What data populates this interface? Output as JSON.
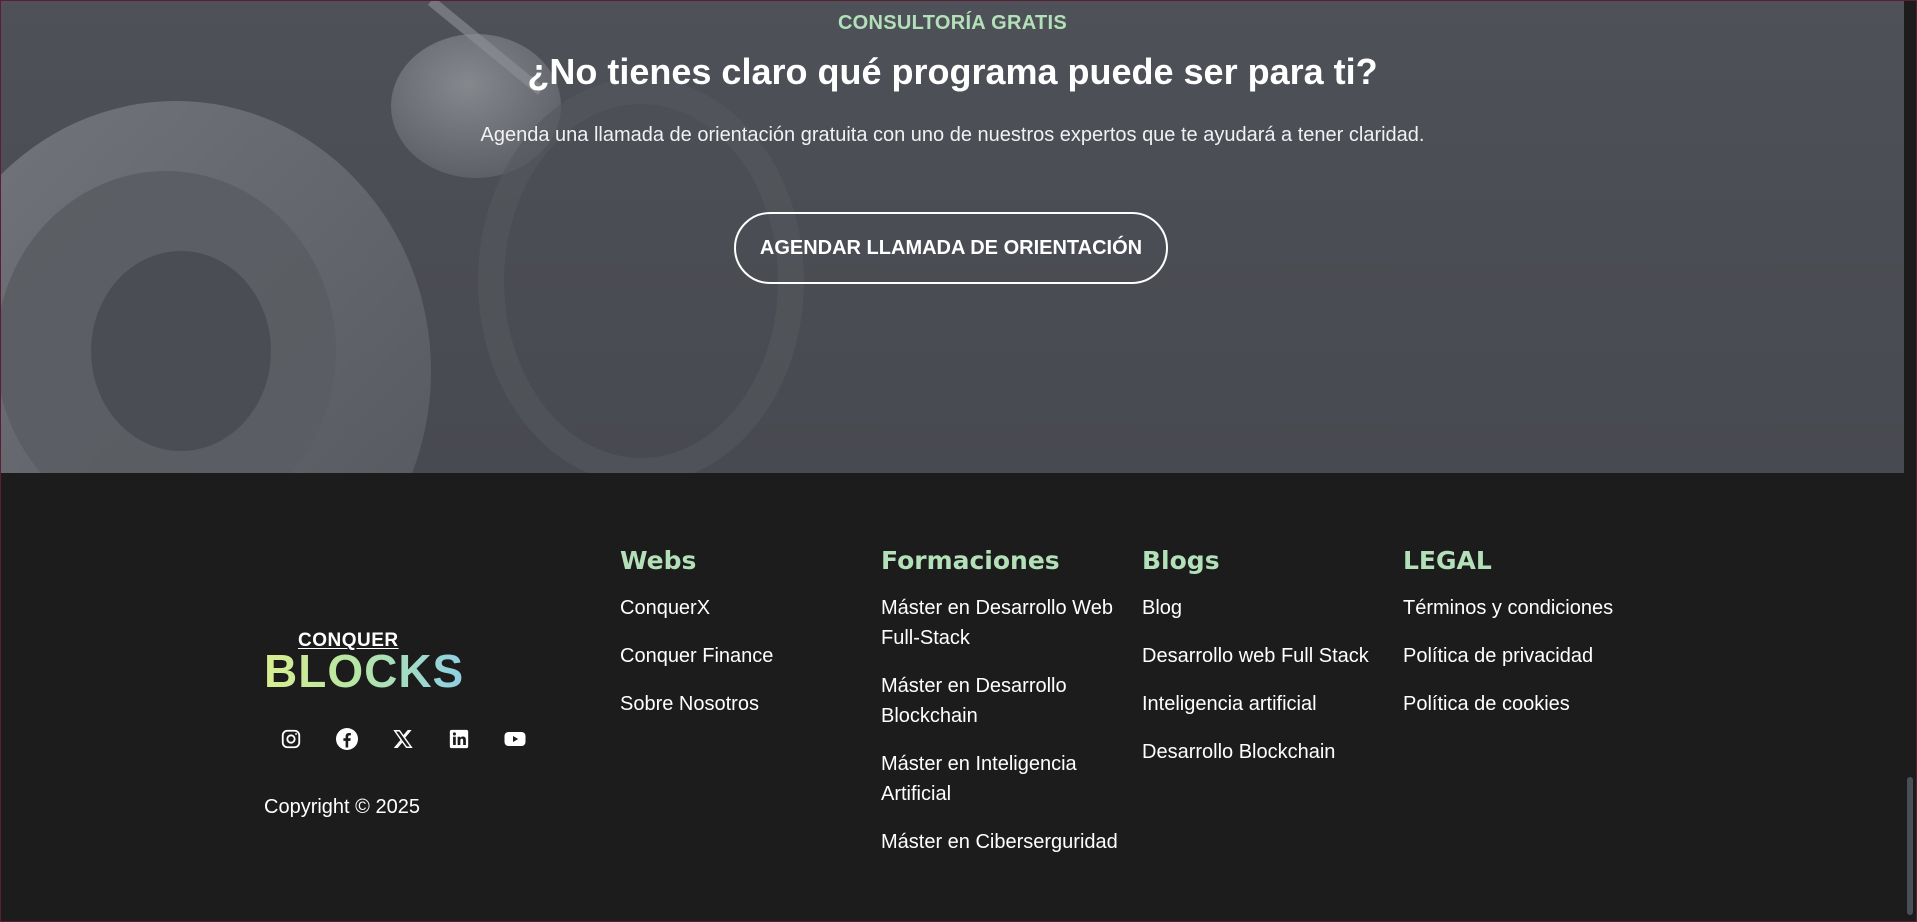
{
  "cta": {
    "eyebrow": "CONSULTORÍA GRATIS",
    "title": "¿No tienes claro qué programa puede ser para ti?",
    "subtitle": "Agenda una llamada de orientación gratuita con uno de nuestros expertos que te ayudará a tener claridad.",
    "button_label": "AGENDAR LLAMADA DE ORIENTACIÓN"
  },
  "brand": {
    "logo_top": "CONQUER",
    "logo_bottom": "BLOCKS",
    "copyright": "Copyright © 2025",
    "socials": [
      {
        "icon": "instagram-icon"
      },
      {
        "icon": "facebook-icon"
      },
      {
        "icon": "x-twitter-icon"
      },
      {
        "icon": "linkedin-icon"
      },
      {
        "icon": "youtube-icon"
      }
    ]
  },
  "columns": [
    {
      "heading": "Webs",
      "links": [
        "ConquerX",
        "Conquer Finance",
        "Sobre Nosotros"
      ]
    },
    {
      "heading": "Formaciones",
      "links": [
        "Máster en Desarrollo Web Full-Stack",
        "Máster en Desarrollo Blockchain",
        "Máster en Inteligencia Artificial",
        "Máster en Ciberserguridad"
      ]
    },
    {
      "heading": "Blogs",
      "links": [
        "Blog",
        "Desarrollo web Full Stack",
        "Inteligencia artificial",
        "Desarrollo Blockchain"
      ]
    },
    {
      "heading": "LEGAL",
      "links": [
        "Términos y condiciones",
        "Política de privacidad",
        "Política de cookies"
      ]
    }
  ],
  "colors": {
    "accent": "#b3e0b8",
    "footer_bg": "#1c1c1c",
    "cta_bg": "#4b4e54"
  }
}
